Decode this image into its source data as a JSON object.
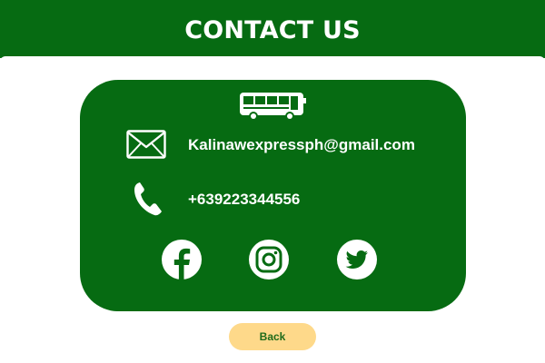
{
  "header": {
    "title": "CONTACT US"
  },
  "card": {
    "top_icon": "bus-icon",
    "email": {
      "icon": "envelope-icon",
      "text": "Kalinawexpressph@gmail.com"
    },
    "phone": {
      "icon": "phone-icon",
      "text": "+639223344556"
    },
    "socials": [
      {
        "icon": "facebook-icon"
      },
      {
        "icon": "instagram-icon"
      },
      {
        "icon": "twitter-icon"
      }
    ]
  },
  "back_button": {
    "label": "Back"
  },
  "colors": {
    "brand_green": "#066b12",
    "button_yellow": "#fed98a",
    "button_text": "#1f6b1a",
    "white": "#ffffff"
  }
}
